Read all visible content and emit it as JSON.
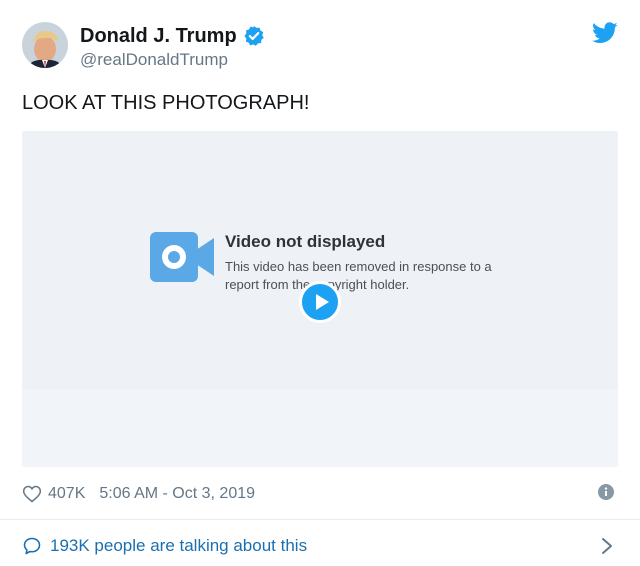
{
  "tweet": {
    "author": {
      "display_name": "Donald J. Trump",
      "handle": "@realDonaldTrump",
      "verified": true,
      "avatar_icon": "profile-photo"
    },
    "text": "LOOK AT THIS PHOTOGRAPH!",
    "media": {
      "notice_title": "Video not displayed",
      "notice_body": "This video has been removed in response to a report from the copyright holder.",
      "icon": "video-camera-icon",
      "play_icon": "play-icon"
    },
    "likes": "407K",
    "timestamp": "5:06 AM - Oct 3, 2019",
    "talking": "193K people are talking about this"
  },
  "colors": {
    "brand_blue": "#1da1f2",
    "link_blue": "#1b6fb0",
    "text_primary": "#14171a",
    "text_secondary": "#657786",
    "media_background": "#eef1f5",
    "divider": "#e6ecf0"
  },
  "icons": [
    "verified-badge-icon",
    "twitter-bird-icon",
    "heart-icon",
    "info-icon",
    "speech-bubble-icon",
    "chevron-right-icon"
  ]
}
